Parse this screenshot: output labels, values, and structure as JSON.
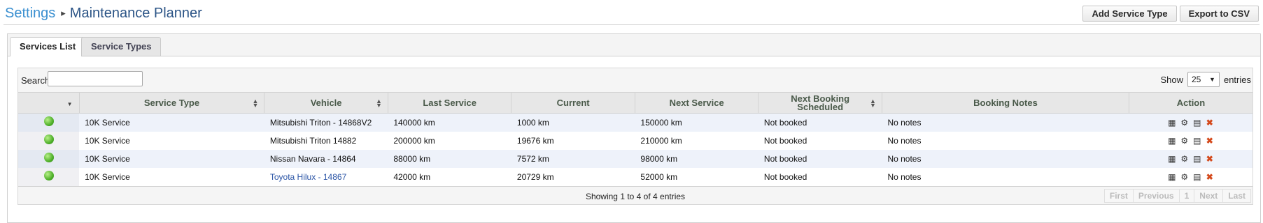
{
  "header": {
    "breadcrumb_root": "Settings",
    "breadcrumb_separator": "▸",
    "page_title": "Maintenance Planner",
    "add_service_type": "Add Service Type",
    "export_csv": "Export to CSV"
  },
  "tabs": [
    {
      "label": "Services List",
      "active": true
    },
    {
      "label": "Service Types",
      "active": false
    }
  ],
  "table_controls": {
    "search_label": "Search:",
    "search_value": "",
    "show_label": "Show",
    "page_size": "25",
    "entries_label": "entries"
  },
  "columns": [
    "",
    "Service Type",
    "Vehicle",
    "Last Service",
    "Current",
    "Next Service",
    "Next Booking Scheduled",
    "Booking Notes",
    "Action"
  ],
  "rows": [
    {
      "service_type": "10K Service",
      "vehicle": "Mitsubishi Triton - 14868V2",
      "last_service": "140000 km",
      "current": "1000 km",
      "next_service": "150000 km",
      "next_booking": "Not booked",
      "notes": "No notes",
      "status_color": "#4fb02a"
    },
    {
      "service_type": "10K Service",
      "vehicle": "Mitsubishi Triton 14882",
      "last_service": "200000 km",
      "current": "19676 km",
      "next_service": "210000 km",
      "next_booking": "Not booked",
      "notes": "No notes",
      "status_color": "#4fb02a"
    },
    {
      "service_type": "10K Service",
      "vehicle": "Nissan Navara - 14864",
      "last_service": "88000 km",
      "current": "7572 km",
      "next_service": "98000 km",
      "next_booking": "Not booked",
      "notes": "No notes",
      "status_color": "#4fb02a"
    },
    {
      "service_type": "10K Service",
      "vehicle": "Toyota Hilux - 14867",
      "last_service": "42000 km",
      "current": "20729 km",
      "next_service": "52000 km",
      "next_booking": "Not booked",
      "notes": "No notes",
      "status_color": "#4fb02a"
    }
  ],
  "action_icons": [
    "calendar-icon",
    "gears-icon",
    "book-icon",
    "delete-icon"
  ],
  "footer": {
    "info": "Showing 1 to 4 of 4 entries",
    "first": "First",
    "previous": "Previous",
    "page": "1",
    "next": "Next",
    "last": "Last"
  },
  "colors": {
    "link": "#3a8fd0",
    "title": "#2b5486",
    "status_ok": "#4fb02a",
    "delete": "#d4491b"
  }
}
